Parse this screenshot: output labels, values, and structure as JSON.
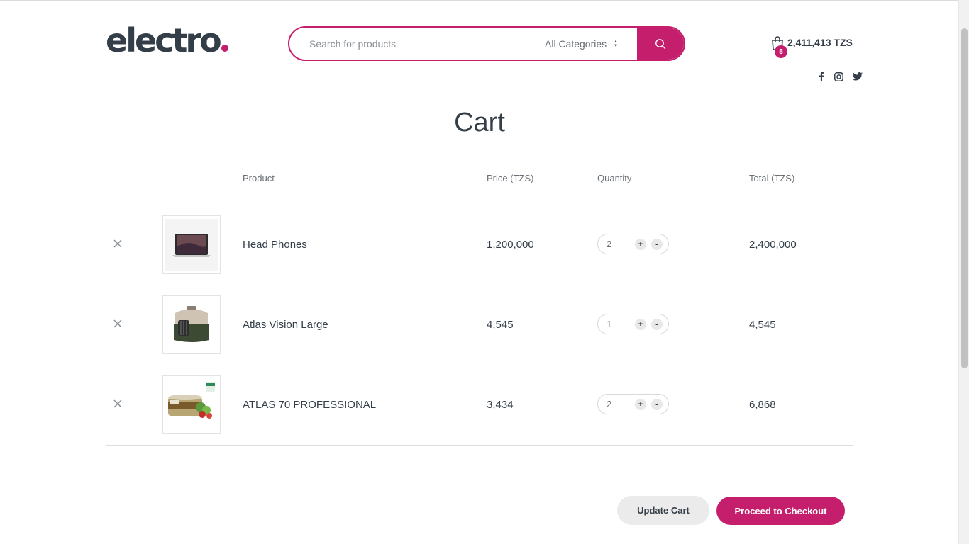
{
  "header": {
    "logo_text": "electro",
    "search": {
      "placeholder": "Search for products"
    },
    "category_select": {
      "selected": "All Categories"
    },
    "cart": {
      "count": "5",
      "total": "2,411,413 TZS"
    },
    "social": [
      "facebook-icon",
      "instagram-icon",
      "twitter-icon"
    ]
  },
  "page": {
    "title": "Cart"
  },
  "table": {
    "headers": {
      "product": "Product",
      "price": "Price (TZS)",
      "quantity": "Quantity",
      "total": "Total (TZS)"
    },
    "rows": [
      {
        "name": "Head Phones",
        "price": "1,200,000",
        "qty": "2",
        "total": "2,400,000",
        "thumb": "laptop-image"
      },
      {
        "name": "Atlas Vision Large",
        "price": "4,545",
        "qty": "1",
        "total": "4,545",
        "thumb": "pet-carrier-image"
      },
      {
        "name": "ATLAS 70 PROFESSIONAL",
        "price": "3,434",
        "qty": "2",
        "total": "6,868",
        "thumb": "pet-food-can-image"
      }
    ],
    "qty_plus": "+",
    "qty_minus": "-"
  },
  "actions": {
    "update_label": "Update Cart",
    "checkout_label": "Proceed to Checkout"
  },
  "colors": {
    "accent": "#c51e6c",
    "text": "#333e48",
    "muted": "#6a6f75"
  }
}
